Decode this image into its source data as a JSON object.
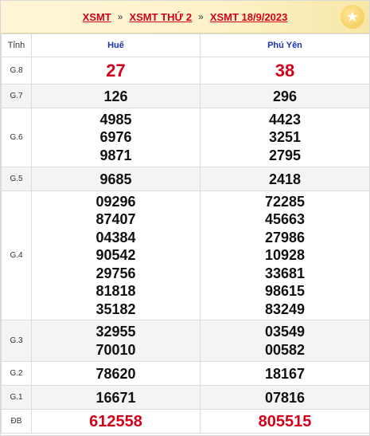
{
  "breadcrumb": {
    "items": [
      "XSMT",
      "XSMT THỨ 2",
      "XSMT 18/9/2023"
    ],
    "separator": "»"
  },
  "table": {
    "header": {
      "label": "Tỉnh",
      "col1": "Huế",
      "col2": "Phú Yên"
    },
    "rows": [
      {
        "label": "G.8",
        "col1": [
          "27"
        ],
        "col2": [
          "38"
        ]
      },
      {
        "label": "G.7",
        "col1": [
          "126"
        ],
        "col2": [
          "296"
        ]
      },
      {
        "label": "G.6",
        "col1": [
          "4985",
          "6976",
          "9871"
        ],
        "col2": [
          "4423",
          "3251",
          "2795"
        ]
      },
      {
        "label": "G.5",
        "col1": [
          "9685"
        ],
        "col2": [
          "2418"
        ]
      },
      {
        "label": "G.4",
        "col1": [
          "09296",
          "87407",
          "04384",
          "90542",
          "29756",
          "81818",
          "35182"
        ],
        "col2": [
          "72285",
          "45663",
          "27986",
          "10928",
          "33681",
          "98615",
          "83249"
        ]
      },
      {
        "label": "G.3",
        "col1": [
          "32955",
          "70010"
        ],
        "col2": [
          "03549",
          "00582"
        ]
      },
      {
        "label": "G.2",
        "col1": [
          "78620"
        ],
        "col2": [
          "18167"
        ]
      },
      {
        "label": "G.1",
        "col1": [
          "16671"
        ],
        "col2": [
          "07816"
        ]
      },
      {
        "label": "ĐB",
        "col1": [
          "612558"
        ],
        "col2": [
          "805515"
        ]
      }
    ]
  },
  "colors": {
    "accent": "#d0021b",
    "header_blue": "#1a33a6",
    "alt_row": "#f4f4f4"
  },
  "icons": {
    "badge": "star-icon"
  }
}
